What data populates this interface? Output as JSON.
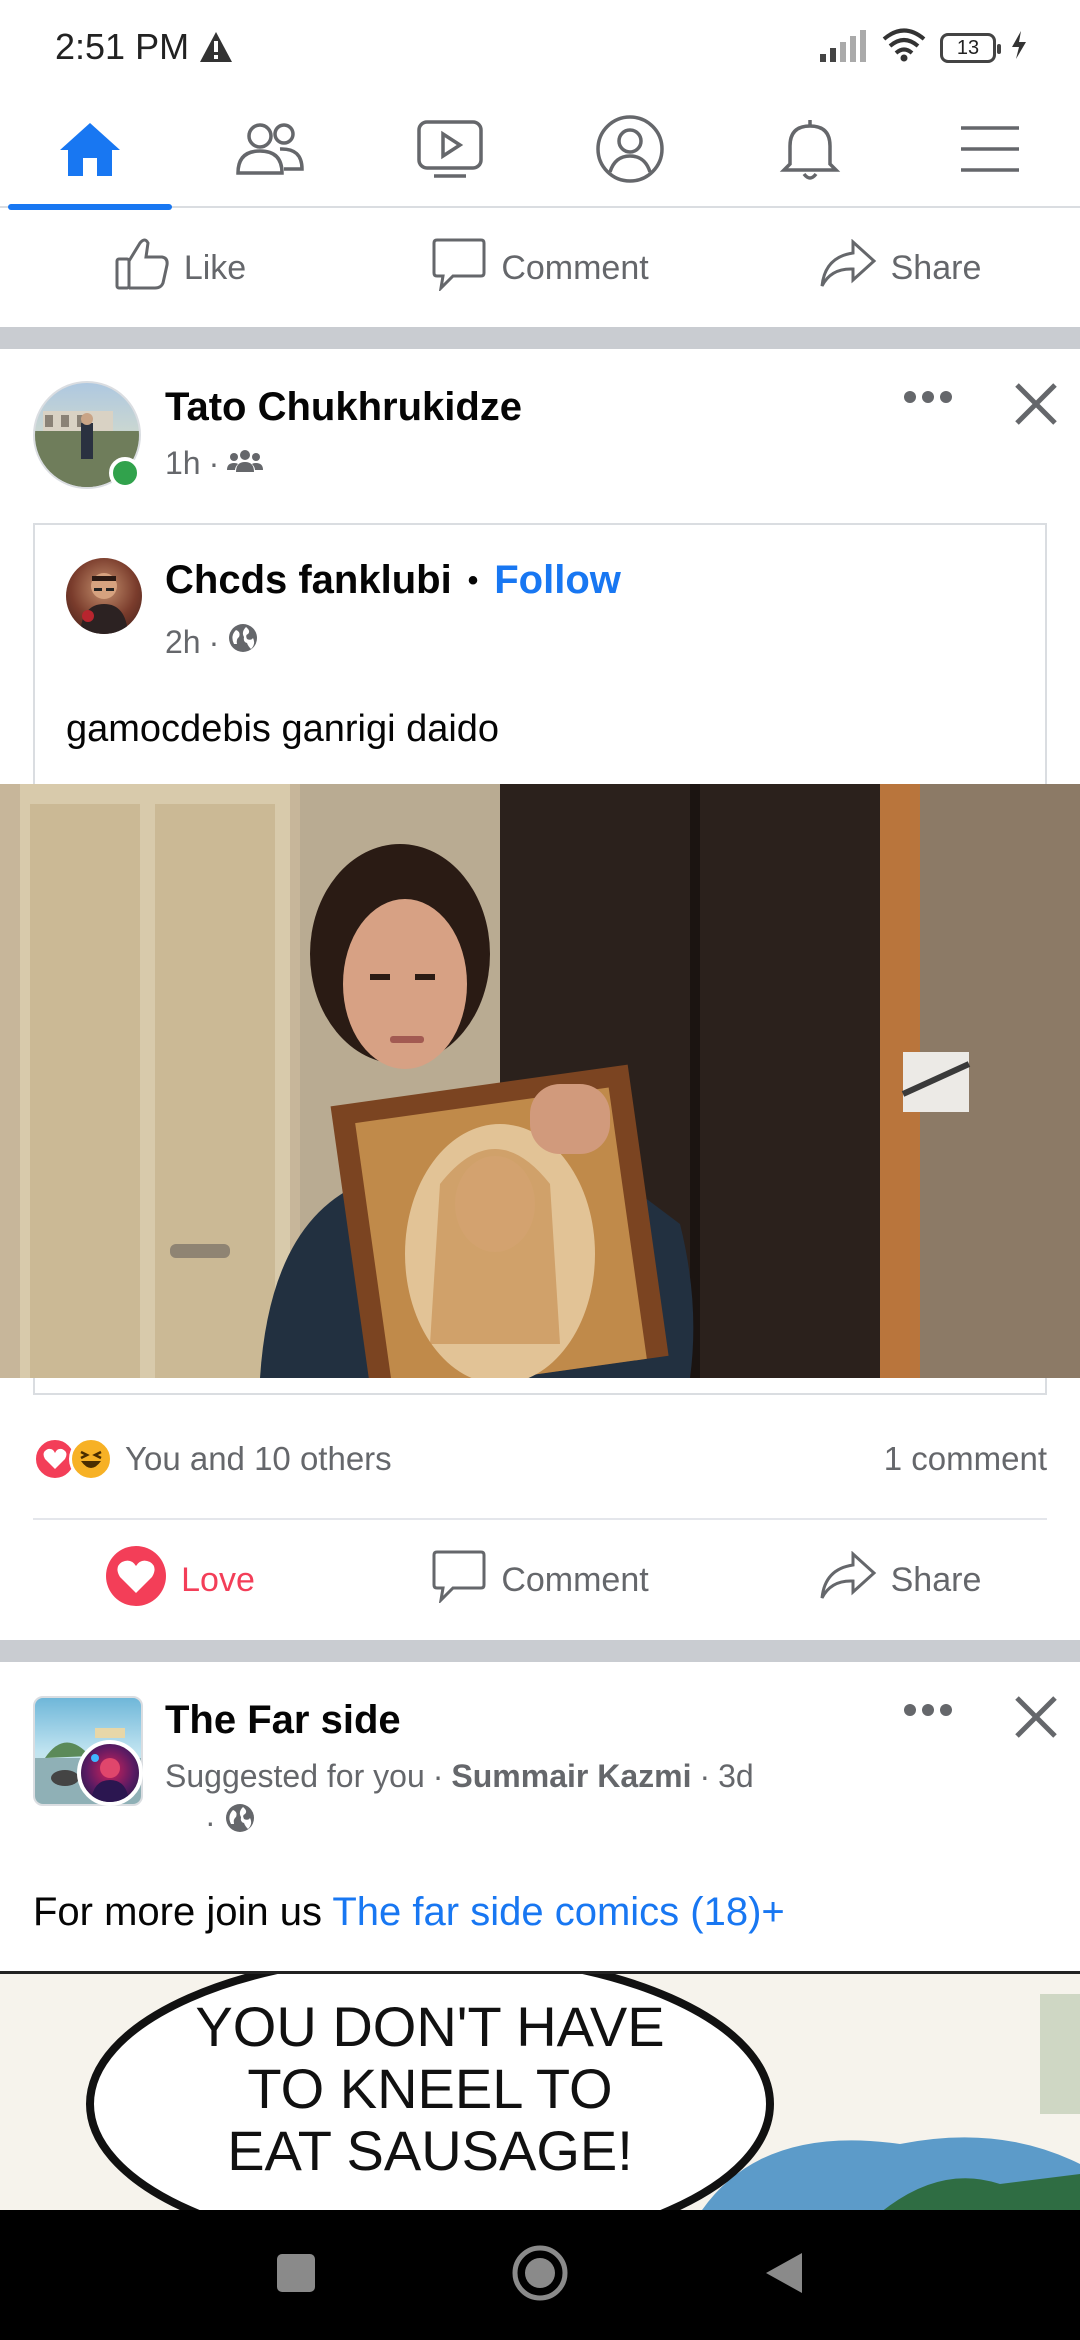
{
  "status": {
    "time": "2:51 PM",
    "battery": "13"
  },
  "nav": {
    "tabs": [
      "home",
      "friends",
      "watch",
      "profile",
      "notifications",
      "menu"
    ],
    "active": "home"
  },
  "prev_actions": {
    "like": "Like",
    "comment": "Comment",
    "share": "Share"
  },
  "post1": {
    "author": "Tato Chukhrukidze",
    "time": "1h",
    "audience_icon": "friends-group-icon",
    "shared": {
      "author": "Chcds fanklubi",
      "separator": "•",
      "follow": "Follow",
      "time": "2h",
      "audience_icon": "globe-icon",
      "text": "gamocdebis ganrigi daido"
    },
    "reactions": {
      "text": "You and 10 others",
      "comments": "1 comment"
    },
    "actions": {
      "love": "Love",
      "comment": "Comment",
      "share": "Share"
    }
  },
  "post2": {
    "author": "The Far side",
    "suggested": "Suggested for you",
    "via": "Summair Kazmi",
    "time": "3d",
    "text_prefix": "For more join us",
    "link": "The far side comics (18)+",
    "comic_text": [
      "YOU DON'T HAVE",
      "TO KNEEL TO",
      "EAT SAUSAGE!"
    ]
  },
  "colors": {
    "accent": "#1877f2",
    "love": "#f33e58",
    "muted": "#65676b",
    "online": "#31a24c"
  }
}
